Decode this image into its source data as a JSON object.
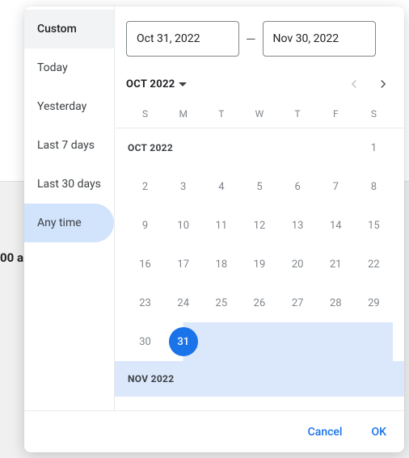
{
  "background": {
    "text_fragment": "00 a"
  },
  "sidebar": {
    "items": [
      {
        "label": "Custom"
      },
      {
        "label": "Today"
      },
      {
        "label": "Yesterday"
      },
      {
        "label": "Last 7 days"
      },
      {
        "label": "Last 30 days"
      },
      {
        "label": "Any time"
      }
    ]
  },
  "inputs": {
    "start": "Oct 31, 2022",
    "end": "Nov 30, 2022",
    "separator": "—"
  },
  "header": {
    "month_label": "OCT 2022"
  },
  "dow": [
    "S",
    "M",
    "T",
    "W",
    "T",
    "F",
    "S"
  ],
  "calendar": {
    "oct": {
      "title": "OCT 2022",
      "first_row_trailing": "1",
      "weeks": [
        [
          "2",
          "3",
          "4",
          "5",
          "6",
          "7",
          "8"
        ],
        [
          "9",
          "10",
          "11",
          "12",
          "13",
          "14",
          "15"
        ],
        [
          "16",
          "17",
          "18",
          "19",
          "20",
          "21",
          "22"
        ],
        [
          "23",
          "24",
          "25",
          "26",
          "27",
          "28",
          "29"
        ]
      ],
      "last_row": [
        "30",
        "31"
      ],
      "selected_start": "31"
    },
    "nov": {
      "title": "NOV 2022"
    }
  },
  "footer": {
    "cancel": "Cancel",
    "ok": "OK"
  }
}
